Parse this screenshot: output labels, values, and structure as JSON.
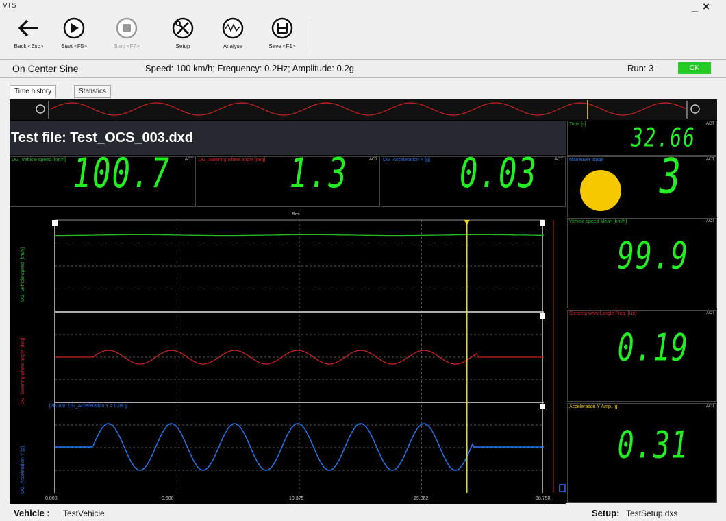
{
  "window": {
    "title": "VTS",
    "minimize": "_",
    "close": "×"
  },
  "toolbar": {
    "buttons": [
      {
        "label": "Back <Esc>",
        "icon": "back-arrow-icon",
        "enabled": true
      },
      {
        "label": "Start <F5>",
        "icon": "play-icon",
        "enabled": true
      },
      {
        "label": "Stop <F7>",
        "icon": "stop-icon",
        "enabled": false
      },
      {
        "label": "Setup",
        "icon": "tools-icon",
        "enabled": true
      },
      {
        "label": "Analyse",
        "icon": "analyse-icon",
        "enabled": true
      },
      {
        "label": "Save <F1>",
        "icon": "save-icon",
        "enabled": true
      }
    ]
  },
  "status": {
    "test_name": "On Center Sine",
    "params": "Speed: 100 km/h; Frequency: 0.2Hz; Amplitude: 0.2g",
    "run": "Run: 3",
    "result": "OK",
    "result_color": "#22cc22"
  },
  "tabs": [
    {
      "label": "Time history",
      "active": true
    },
    {
      "label": "Statistics",
      "active": false
    }
  ],
  "file_title": "Test file: Test_OCS_003.dxd",
  "panels": {
    "time": {
      "label": "Time [s]",
      "value": "32.66",
      "act": "ACT"
    },
    "vehicle_speed": {
      "label": "DG_Vehicle speed [km/h]",
      "value": "100.7",
      "act": "ACT",
      "label_color": "#22bb22"
    },
    "steering_angle": {
      "label": "DG_Steering wheel angle [deg]",
      "value": "1.3",
      "act": "ACT",
      "label_color": "#dd2222"
    },
    "acceleration": {
      "label": "DG_Acceleration Y [g]",
      "value": "0.03",
      "act": "ACT",
      "label_color": "#2277ee"
    },
    "maneuver_stage": {
      "label": "Maneuver stage",
      "value": "3",
      "act": "ACT",
      "indicator_color": "#f5c800"
    },
    "speed_mean": {
      "label": "Vehicle speed Mean [km/h]",
      "value": "99.9",
      "act": "ACT"
    },
    "steer_freq": {
      "label": "Steering wheel angle Freq. [Hz]",
      "value": "0.19",
      "act": "ACT"
    },
    "accel_amp": {
      "label": "Acceleration Y Amp. [g]",
      "value": "0.31",
      "act": "ACT"
    }
  },
  "plots": {
    "rec_label": "Rec",
    "speed_ylabel": "DG_Vehicle speed [km/h]",
    "steer_ylabel": "DG_Steering wheel angle [deg]",
    "accel_ylabel": "DG_Acceleration Y [g]",
    "cursor_readout": "[30.000; DG_Acceleration Y = 0.08 g",
    "x_ticks": [
      "0.000",
      "9.688",
      "19.375",
      "29.062",
      "38.750"
    ],
    "x_range": [
      0,
      38.75
    ],
    "cursor_time": 32.66,
    "speed_color": "#22bb22",
    "steer_color": "#cc2222",
    "accel_color": "#2277ee",
    "cursor_color": "#eedd22"
  },
  "footer": {
    "vehicle_label": "Vehicle :",
    "vehicle": "TestVehicle",
    "setup_label": "Setup:",
    "setup": "TestSetup.dxs"
  }
}
